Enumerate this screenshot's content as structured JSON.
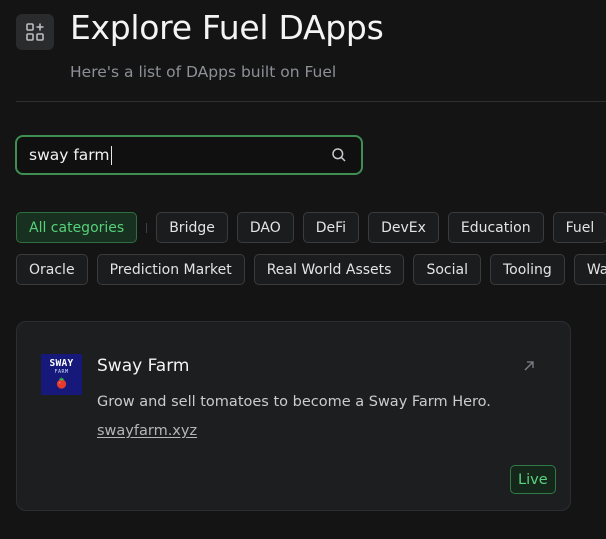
{
  "header": {
    "title": "Explore Fuel DApps",
    "subtitle": "Here's a list of DApps built on Fuel",
    "icon": "grid-plus-icon"
  },
  "search": {
    "value": "sway farm",
    "placeholder": "",
    "icon": "search-icon"
  },
  "categories": {
    "all": "All categories",
    "row1": [
      "Bridge",
      "DAO",
      "DeFi",
      "DevEx",
      "Education",
      "Fuel"
    ],
    "row2": [
      "Oracle",
      "Prediction Market",
      "Real World Assets",
      "Social",
      "Tooling",
      "Wa"
    ]
  },
  "results": [
    {
      "name": "Sway Farm",
      "logo_text": "SWAY",
      "logo_subtext": "FARM",
      "description": "Grow and sell tomatoes to become a Sway Farm Hero.",
      "link": "swayfarm.xyz",
      "status": "Live",
      "link_icon": "external-arrow-icon"
    }
  ],
  "colors": {
    "background": "#141414",
    "accent_green": "#56d07a",
    "search_border": "#3f8f53",
    "card_background": "#1d1e20",
    "logo_background": "#16197a"
  }
}
